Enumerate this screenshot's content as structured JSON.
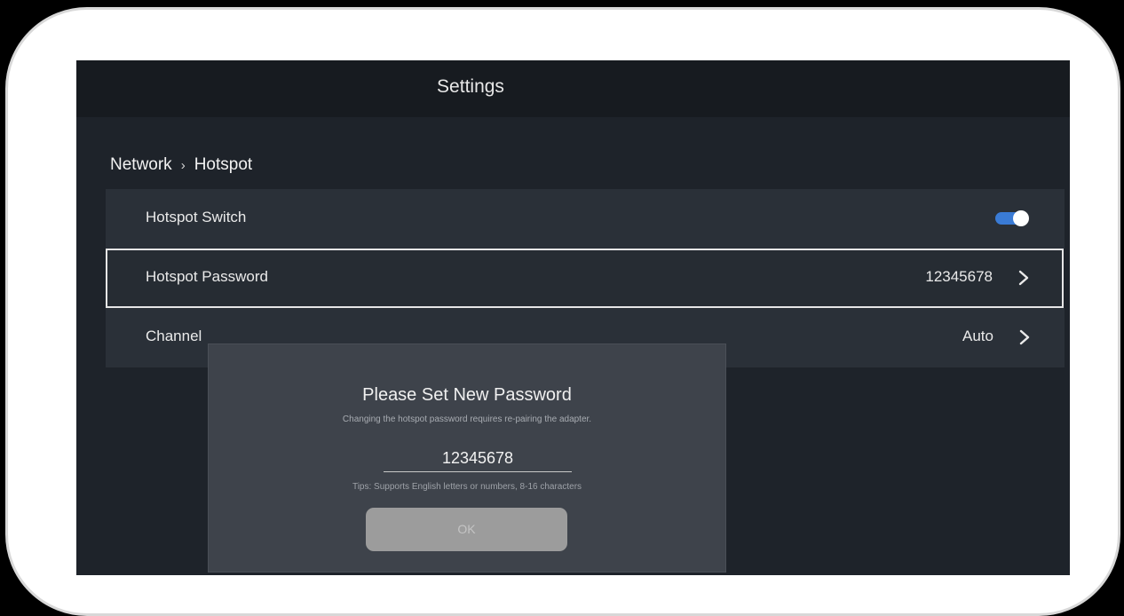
{
  "header": {
    "title": "Settings"
  },
  "breadcrumb": {
    "parent": "Network",
    "separator": "›",
    "current": "Hotspot"
  },
  "settings": {
    "rows": [
      {
        "label": "Hotspot Switch",
        "type": "toggle",
        "enabled": true
      },
      {
        "label": "Hotspot Password",
        "value": "12345678",
        "type": "link",
        "focused": true
      },
      {
        "label": "Channel",
        "value": "Auto",
        "type": "link"
      }
    ]
  },
  "dialog": {
    "title": "Please Set New Password",
    "subtitle": "Changing the hotspot password requires re-pairing the adapter.",
    "password_value": "12345678",
    "tips": "Tips: Supports English letters or numbers, 8-16 characters",
    "ok_label": "OK"
  },
  "colors": {
    "toggle_on": "#3a7bd5",
    "background": "#1e232a",
    "dialog": "#3e434b"
  },
  "icons": {
    "chevron": "chevron-right-icon",
    "toggle": "toggle-switch"
  }
}
